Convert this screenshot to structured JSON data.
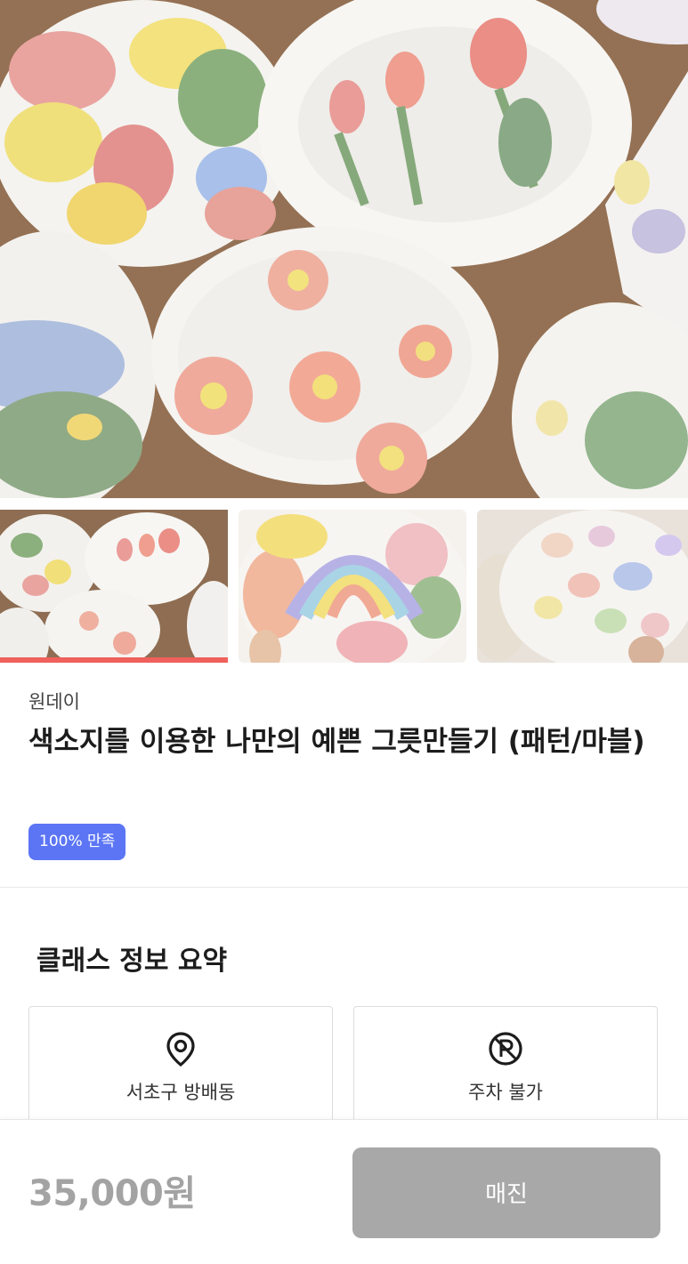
{
  "gallery": {
    "main_image_alt": "painted ceramic plates",
    "thumbnails": [
      {
        "name": "thumbnail-1",
        "active": true
      },
      {
        "name": "thumbnail-2",
        "active": false
      },
      {
        "name": "thumbnail-3",
        "active": false
      }
    ],
    "active_color": "#f0605c"
  },
  "product": {
    "provider": "원데이",
    "title": "색소지를 이용한 나만의 예쁜 그릇만들기 (패턴/마블)",
    "badge": "100% 만족",
    "badge_color": "#5b75f5"
  },
  "summary": {
    "heading": "클래스 정보 요약",
    "items": [
      {
        "icon": "location-pin-icon",
        "label": "서초구 방배동"
      },
      {
        "icon": "no-parking-icon",
        "label": "주차 불가"
      }
    ]
  },
  "purchase": {
    "price": "35,000원",
    "button_label": "매진",
    "button_color": "#a8a8a8"
  }
}
